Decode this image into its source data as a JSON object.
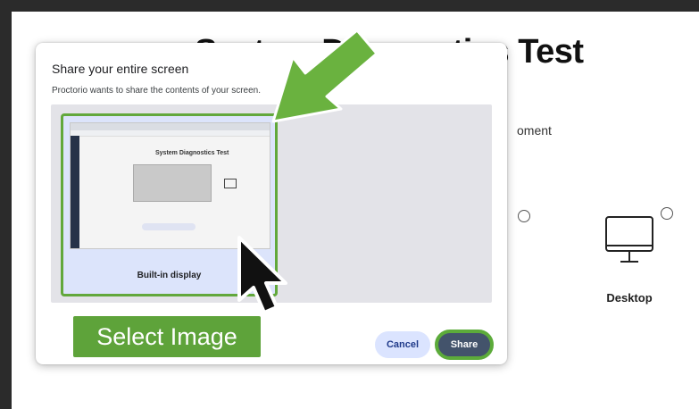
{
  "background": {
    "title": "System Diagnostics Test",
    "partial_text": "oment",
    "desktop_option": {
      "label": "Desktop",
      "icon": "monitor-icon"
    }
  },
  "dialog": {
    "title": "Share your entire screen",
    "subtitle": "Proctorio wants to share the contents of your screen.",
    "screens": [
      {
        "label": "Built-in display",
        "selected": true,
        "thumb_title": "System Diagnostics Test"
      }
    ],
    "buttons": {
      "cancel": "Cancel",
      "share": "Share"
    }
  },
  "annotations": {
    "callout_text": "Select Image",
    "accent_color": "#5ea33a",
    "arrow_icon": "green-arrow-icon",
    "cursor_icon": "mouse-pointer-icon"
  }
}
